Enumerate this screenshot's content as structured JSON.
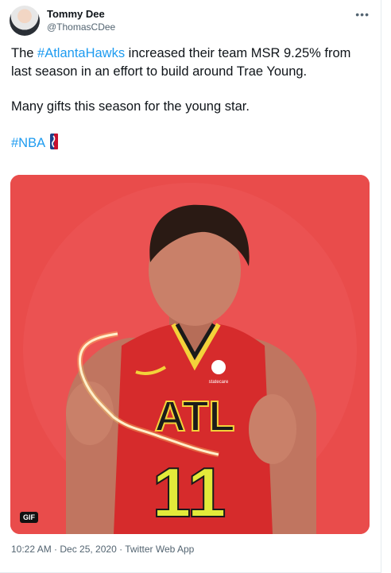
{
  "user": {
    "display_name": "Tommy Dee",
    "handle": "@ThomasCDee"
  },
  "tweet": {
    "line1_prefix": "The ",
    "hashtag_team": "#AtlantaHawks",
    "line1_suffix": " increased their team MSR 9.25% from last season in an effort to build around Trae Young.",
    "line2": "Many gifts this season for the young star.",
    "hashtag_league": "#NBA"
  },
  "media": {
    "badge": "GIF",
    "jersey_text": "ATL",
    "jersey_number": "11",
    "jersey_patch": "statecare"
  },
  "meta": {
    "timestamp": "10:22 AM · Dec 25, 2020 · Twitter Web App"
  },
  "more_glyph": "•••"
}
